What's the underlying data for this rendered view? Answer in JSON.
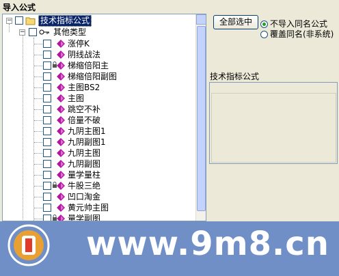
{
  "window": {
    "title": "导入公式"
  },
  "tree": {
    "root": {
      "label": "技术指标公式"
    },
    "group": {
      "label": "其他类型"
    },
    "items": [
      {
        "label": "涨停K",
        "locked": false
      },
      {
        "label": "阴线战法",
        "locked": false
      },
      {
        "label": "梯缩倍阳主",
        "locked": true
      },
      {
        "label": "梯缩倍阳副图",
        "locked": false
      },
      {
        "label": "主图BS2",
        "locked": false
      },
      {
        "label": "主图",
        "locked": false
      },
      {
        "label": "跳空不补",
        "locked": false
      },
      {
        "label": "倍量不破",
        "locked": false
      },
      {
        "label": "九阴主图1",
        "locked": false
      },
      {
        "label": "九阴副图1",
        "locked": false
      },
      {
        "label": "九阴主图",
        "locked": false
      },
      {
        "label": "九阴副图",
        "locked": false
      },
      {
        "label": "量学量柱",
        "locked": false
      },
      {
        "label": "牛股三绝",
        "locked": true
      },
      {
        "label": "凹口淘金",
        "locked": false
      },
      {
        "label": "黄元帅主图",
        "locked": false
      },
      {
        "label": "量学副图",
        "locked": true
      }
    ]
  },
  "controls": {
    "select_all_label": "全部选中",
    "options": [
      {
        "label": "不导入同名公式",
        "selected": true
      },
      {
        "label": "覆盖同名(非系统)",
        "selected": false
      }
    ]
  },
  "info": {
    "label": "技术指标公式"
  },
  "watermark": {
    "text": "www.9m8.cn",
    "logo_text": "www.9m8.cn"
  },
  "colors": {
    "selection": "#0a246a",
    "banner": "#6f8fc6",
    "formula_icon": "#b0159a"
  }
}
